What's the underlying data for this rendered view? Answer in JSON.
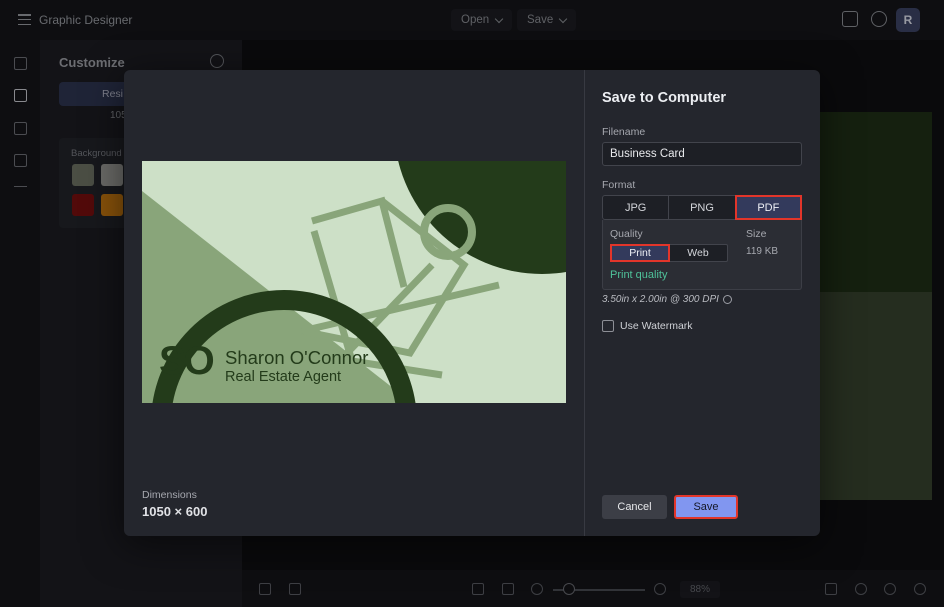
{
  "app": {
    "title": "Graphic Designer",
    "menus": {
      "open": "Open",
      "save": "Save"
    },
    "avatar_initial": "R"
  },
  "panel": {
    "title": "Customize",
    "tab_label": "Resi",
    "sub_value": "105",
    "background_label": "Background",
    "swatches": [
      "#6f7365",
      "#9c9c98",
      "#7a1010",
      "#c9790f"
    ]
  },
  "bottom": {
    "zoom": "88%"
  },
  "modal": {
    "title": "Save to Computer",
    "filename_label": "Filename",
    "filename_value": "Business Card",
    "format_label": "Format",
    "formats": [
      "JPG",
      "PNG",
      "PDF"
    ],
    "selected_format": "PDF",
    "quality_label": "Quality",
    "quality_options": [
      "Print",
      "Web"
    ],
    "selected_quality": "Print",
    "quality_link": "Print quality",
    "size_label": "Size",
    "size_value": "119 KB",
    "dpi_note": "3.50in x 2.00in @ 300 DPI",
    "watermark_label": "Use Watermark",
    "watermark_checked": false,
    "cancel_label": "Cancel",
    "save_label": "Save",
    "dimensions_label": "Dimensions",
    "dimensions_value": "1050 × 600"
  },
  "card": {
    "monogram": "SO",
    "name": "Sharon O'Connor",
    "role": "Real Estate Agent",
    "colors": {
      "background": "#cde0c7",
      "light_green": "#89a57a",
      "dark_green": "#233b1a",
      "text": "#233b1a"
    }
  },
  "colors": {
    "accent": "#8196f0",
    "highlight": "#e2352a",
    "link": "#4fc29a"
  }
}
